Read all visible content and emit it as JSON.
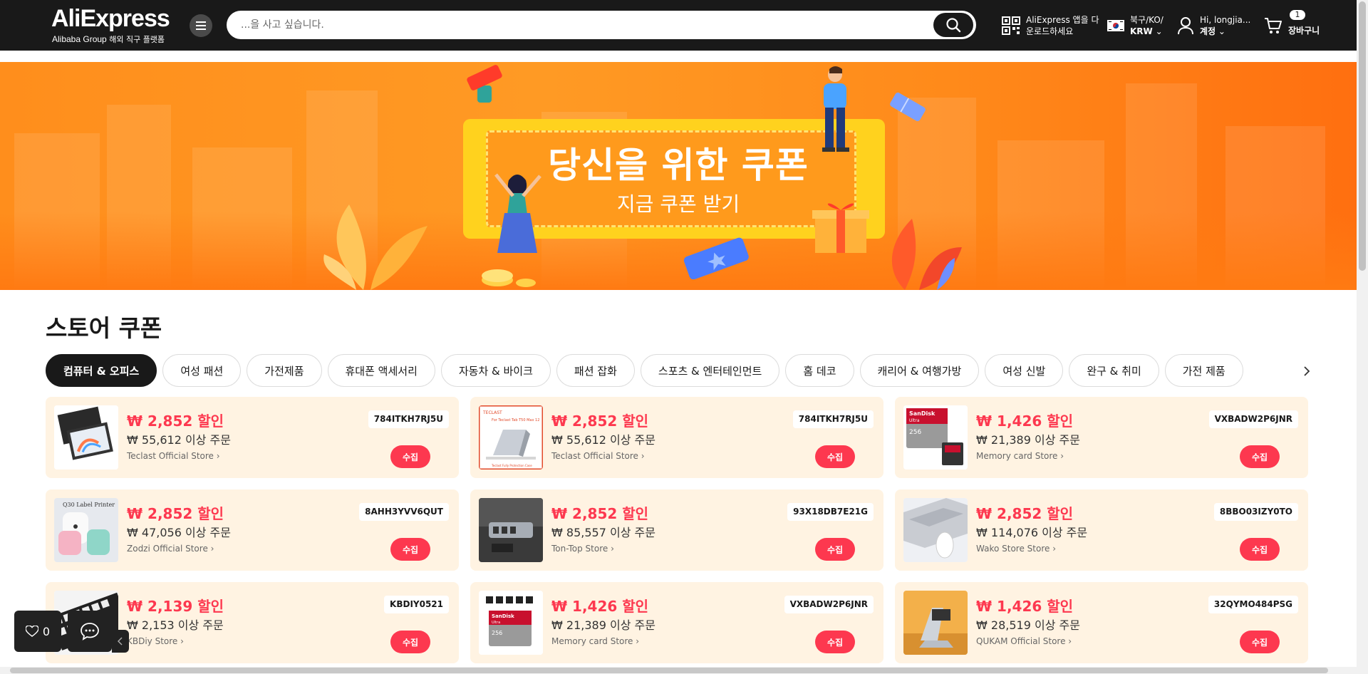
{
  "header": {
    "logo": "AliExpress",
    "logo_sub_en": "Alibaba Group",
    "logo_sub_ko": "해외 직구 플랫폼",
    "search_placeholder": "...을 사고 싶습니다.",
    "app_line1": "AliExpress 앱을 다",
    "app_line2": "운로드하세요",
    "region_line1": "북구/KO/",
    "region_line2": "KRW",
    "account_line1": "Hi, longjia...",
    "account_line2": "계정",
    "cart_count": "1",
    "cart_label": "장바구니"
  },
  "banner": {
    "title": "당신을 위한 쿠폰",
    "subtitle": "지금 쿠폰 받기"
  },
  "section": {
    "title": "스토어 쿠폰"
  },
  "tabs": [
    {
      "label": "컴퓨터 & 오피스",
      "active": true
    },
    {
      "label": "여성 패션"
    },
    {
      "label": "가전제품"
    },
    {
      "label": "휴대폰 액세서리"
    },
    {
      "label": "자동차 & 바이크"
    },
    {
      "label": "패션 잡화"
    },
    {
      "label": "스포츠 & 엔터테인먼트"
    },
    {
      "label": "홈 데코"
    },
    {
      "label": "캐리어 & 여행가방"
    },
    {
      "label": "여성 신발"
    },
    {
      "label": "완구 & 취미"
    },
    {
      "label": "가전 제품"
    }
  ],
  "coupons": [
    {
      "amount": "₩ 2,852 할인",
      "min": "₩ 55,612 이상 주문",
      "store": "Teclast Official Store",
      "code": "784ITKH7RJ5U",
      "btn": "수집"
    },
    {
      "amount": "₩ 2,852 할인",
      "min": "₩ 55,612 이상 주문",
      "store": "Teclast Official Store",
      "code": "784ITKH7RJ5U",
      "btn": "수집"
    },
    {
      "amount": "₩ 1,426 할인",
      "min": "₩ 21,389 이상 주문",
      "store": "Memory card Store",
      "code": "VXBADW2P6JNR",
      "btn": "수집"
    },
    {
      "amount": "₩ 2,852 할인",
      "min": "₩ 47,056 이상 주문",
      "store": "Zodzi Official Store",
      "code": "8AHH3YVV6QUT",
      "btn": "수집"
    },
    {
      "amount": "₩ 2,852 할인",
      "min": "₩ 85,557 이상 주문",
      "store": "Ton-Top Store",
      "code": "93X18DB7E21G",
      "btn": "수집"
    },
    {
      "amount": "₩ 2,852 할인",
      "min": "₩ 114,076 이상 주문",
      "store": "Wako Store Store",
      "code": "8BBO03IZY0TO",
      "btn": "수집"
    },
    {
      "amount": "₩ 2,139 할인",
      "min": "₩ 2,153 이상 주문",
      "store": "KBDiy Store",
      "code": "KBDIY0521",
      "btn": "수집"
    },
    {
      "amount": "₩ 1,426 할인",
      "min": "₩ 21,389 이상 주문",
      "store": "Memory card Store",
      "code": "VXBADW2P6JNR",
      "btn": "수집"
    },
    {
      "amount": "₩ 1,426 할인",
      "min": "₩ 28,519 이상 주문",
      "store": "QUKAM Official Store",
      "code": "32QYMO484PSG",
      "btn": "수집"
    }
  ],
  "thumb_text": {
    "teclast_logo": "TECLAST",
    "teclast_caption": "For Teclast Tab T50 Max 12",
    "teclast_footer": "Teclast Fully Protection Case",
    "sandisk_brand": "SanDisk",
    "sandisk_line": "Ultra",
    "sandisk_capacity": "256",
    "printer_caption": "Q30 Label Printer"
  },
  "widgets": {
    "fav_count": "0"
  },
  "colors": {
    "header_bg": "#191919",
    "accent": "#fd384f",
    "coupon_bg": "#fff3e2",
    "banner_orange": "#ff9a24"
  }
}
